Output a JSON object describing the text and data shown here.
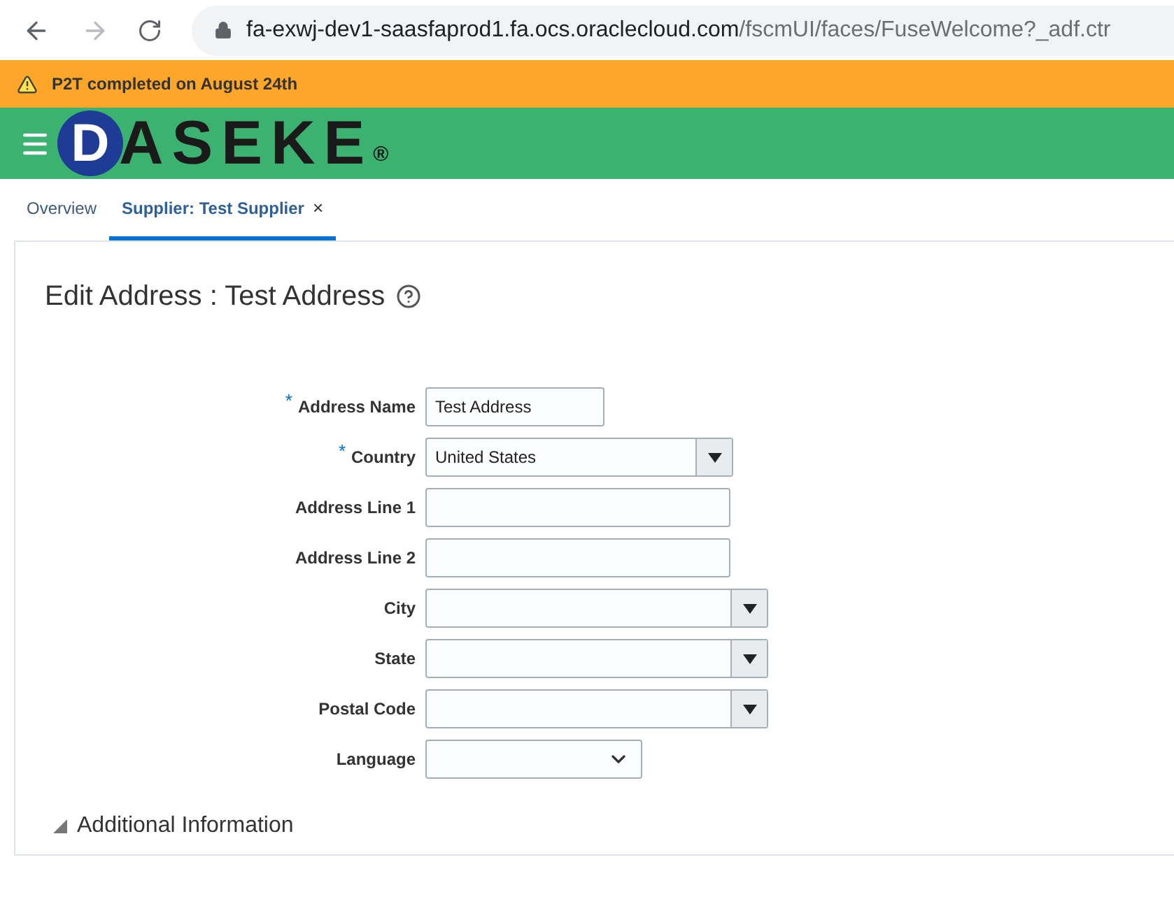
{
  "browser": {
    "url_host": "fa-exwj-dev1-saasfaprod1.fa.ocs.oraclecloud.com",
    "url_path": "/fscmUI/faces/FuseWelcome?_adf.ctr"
  },
  "banner": {
    "message": "P2T completed on August 24th"
  },
  "header": {
    "logo_initial": "D",
    "logo_rest": "ASEKE",
    "logo_mark": "®"
  },
  "tabs": [
    {
      "label": "Overview",
      "selected": false
    },
    {
      "label": "Supplier: Test Supplier",
      "selected": true,
      "close": "×"
    }
  ],
  "page": {
    "title": "Edit Address : Test Address"
  },
  "form": [
    {
      "label": "Address Name",
      "required_mark": "*",
      "kind": "shorttext",
      "value": "Test Address"
    },
    {
      "label": "Country",
      "required_mark": "*",
      "kind": "shortcombo",
      "value": "United States"
    },
    {
      "label": "Address Line 1",
      "kind": "text"
    },
    {
      "label": "Address Line 2",
      "kind": "text"
    },
    {
      "label": "City",
      "kind": "combo"
    },
    {
      "label": "State",
      "kind": "combo"
    },
    {
      "label": "Postal Code",
      "kind": "combo"
    },
    {
      "label": "Language",
      "kind": "select"
    }
  ],
  "section": {
    "label": "Additional Information",
    "expanded": false
  }
}
